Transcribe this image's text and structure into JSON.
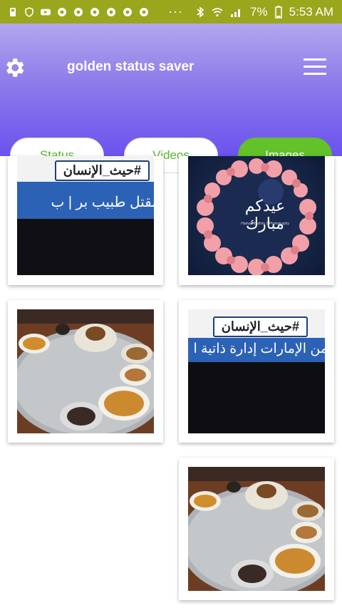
{
  "status_bar": {
    "battery": "7%",
    "time": "5:53 AM",
    "left_icons": [
      "sim-icon",
      "shield-icon",
      "youtube-icon",
      "chrome-icon",
      "chrome-icon",
      "chrome-icon",
      "chrome-icon",
      "chrome-icon",
      "chrome-icon"
    ],
    "overflow": "···"
  },
  "app_bar": {
    "title": "golden status saver",
    "settings_icon": "gear-icon",
    "menu_icon": "hamburger-icon"
  },
  "tabs": [
    {
      "label": "Status",
      "active": false
    },
    {
      "label": "Videos",
      "active": false
    },
    {
      "label": "Images",
      "active": true
    }
  ],
  "images": [
    {
      "kind": "tv-screenshot",
      "tag": "#حيث_الإنسان",
      "band": "مقتل طبيب بر  |  ب"
    },
    {
      "kind": "greeting",
      "script": "عيدكم مبارك",
      "small": "Hamza Ibrahim 2 Photography"
    },
    {
      "kind": "food-tray"
    },
    {
      "kind": "tv-screenshot",
      "tag": "#حيث_الإنسان",
      "band": "من الإمارات إدارة ذاتية ا"
    },
    {
      "kind": "food-tray"
    }
  ],
  "colors": {
    "accent_green": "#63c12a",
    "status_bar": "#9aa61c",
    "header_gradient_top": "#b2a7ee",
    "header_gradient_bottom": "#6b52ef"
  }
}
